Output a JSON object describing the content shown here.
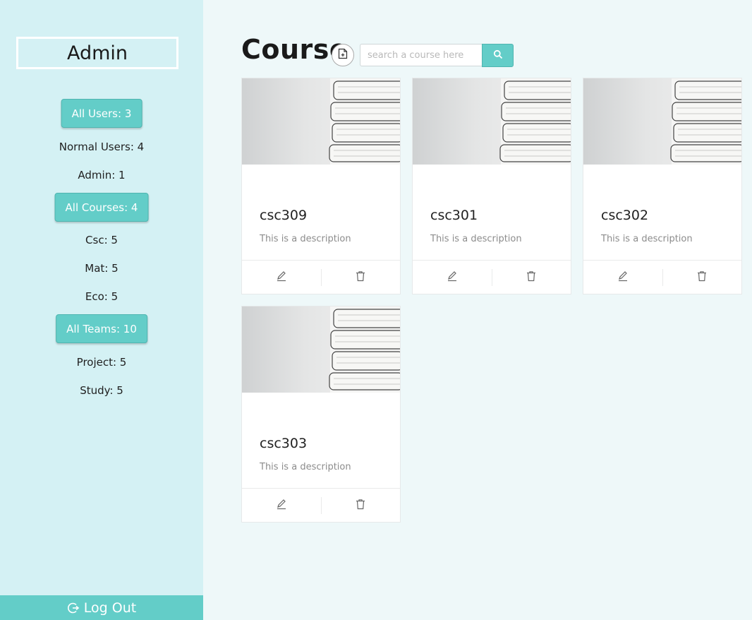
{
  "sidebar": {
    "title": "Admin",
    "users_button": "All Users: 3",
    "normal_users": "Normal Users: 4",
    "admin_count": "Admin: 1",
    "courses_button": "All Courses: 4",
    "csc": "Csc: 5",
    "mat": "Mat: 5",
    "eco": "Eco: 5",
    "teams_button": "All Teams: 10",
    "project": "Project: 5",
    "study": "Study: 5",
    "logout_label": "Log Out",
    "logout_icon": "logout-icon"
  },
  "header": {
    "title": "Course",
    "add_icon": "add-file-icon",
    "search_placeholder": "search a course here",
    "search_icon": "search-icon"
  },
  "courses": [
    {
      "title": "csc309",
      "description": "This is a description"
    },
    {
      "title": "csc301",
      "description": "This is a description"
    },
    {
      "title": "csc302",
      "description": "This is a description"
    },
    {
      "title": "csc303",
      "description": "This is a description"
    }
  ],
  "card_actions": {
    "edit_icon": "edit-icon",
    "delete_icon": "delete-icon"
  },
  "colors": {
    "sidebar_bg": "#d4f1f4",
    "accent": "#63cdc8",
    "page_bg": "#eef8f9"
  }
}
